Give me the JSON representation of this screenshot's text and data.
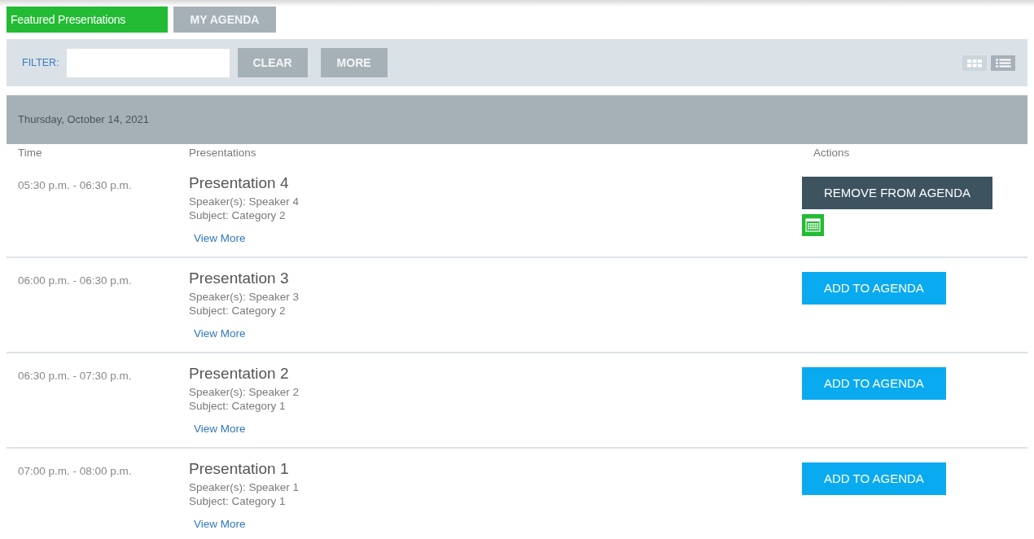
{
  "tabs": [
    {
      "label": "Featured Presentations",
      "selected": true
    },
    {
      "label": "MY AGENDA",
      "selected": false
    }
  ],
  "filter": {
    "label": "FILTER:",
    "buttons": [
      "CLEAR",
      "MORE"
    ],
    "view_modes": [
      {
        "kind": "grid",
        "selected": false
      },
      {
        "kind": "list",
        "selected": true
      }
    ]
  },
  "day": {
    "date": "Thursday, October 14, 2021",
    "columns": [
      "Time",
      "Presentations",
      "Actions"
    ],
    "sessions": [
      {
        "time": "05:30 p.m. - 06:30 p.m.",
        "title": "Presentation 4",
        "speakers": "Speaker(s): Speaker 4",
        "subject": "Subject: Category 2",
        "link": "View More",
        "in_agenda": true,
        "action": "REMOVE FROM AGENDA"
      },
      {
        "time": "06:00 p.m. - 06:30 p.m.",
        "title": "Presentation 3",
        "speakers": "Speaker(s): Speaker 3",
        "subject": "Subject: Category 2",
        "link": "View More",
        "in_agenda": false,
        "action": "ADD TO AGENDA"
      },
      {
        "time": "06:30 p.m. - 07:30 p.m.",
        "title": "Presentation 2",
        "speakers": "Speaker(s): Speaker 2",
        "subject": "Subject: Category 1",
        "link": "View More",
        "in_agenda": false,
        "action": "ADD TO AGENDA"
      },
      {
        "time": "07:00 p.m. - 08:00 p.m.",
        "title": "Presentation 1",
        "speakers": "Speaker(s): Speaker 1",
        "subject": "Subject: Category 1",
        "link": "View More",
        "in_agenda": false,
        "action": "ADD TO AGENDA"
      }
    ]
  }
}
